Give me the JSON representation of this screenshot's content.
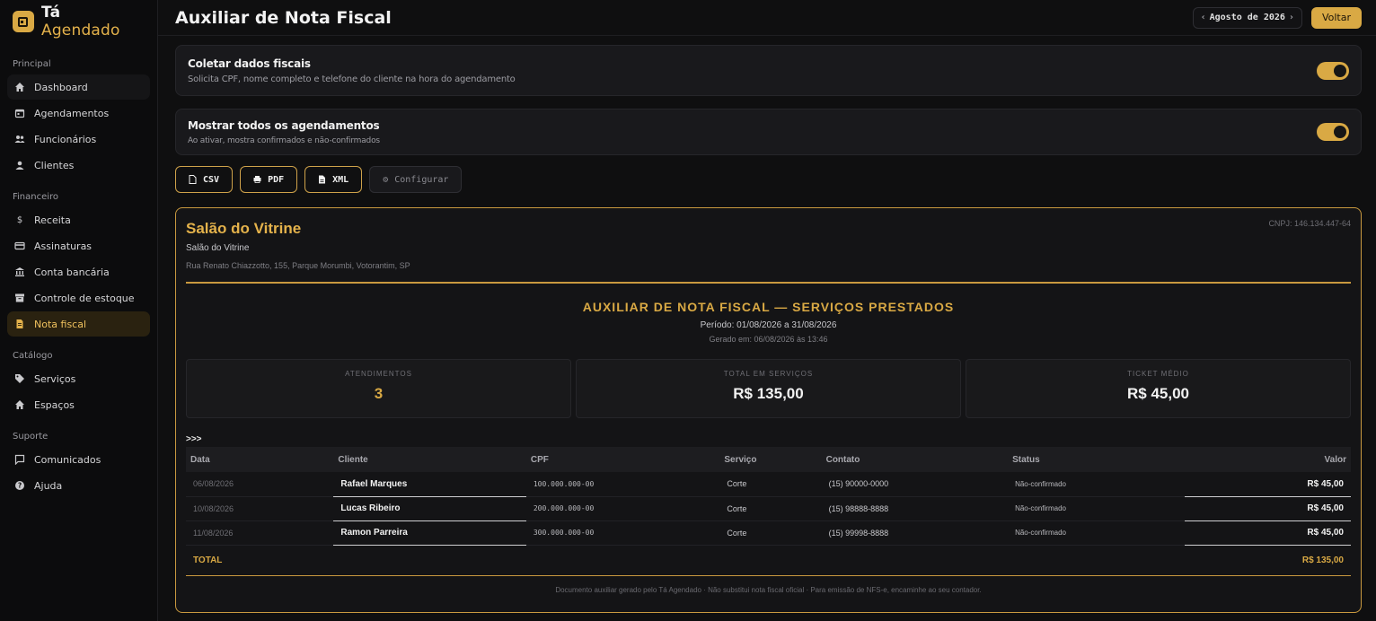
{
  "brand": {
    "name_part1": "Tá",
    "name_part2": "Agendado"
  },
  "sidebar": {
    "sections": [
      {
        "title": "Principal"
      },
      {
        "title": "Financeiro"
      },
      {
        "title": "Catálogo"
      },
      {
        "title": "Suporte"
      }
    ],
    "items": [
      {
        "label": "Dashboard",
        "icon": "home-icon"
      },
      {
        "label": "Agendamentos",
        "icon": "calendar-icon"
      },
      {
        "label": "Funcionários",
        "icon": "users-icon"
      },
      {
        "label": "Clientes",
        "icon": "user-icon"
      },
      {
        "label": "Receita",
        "icon": "dollar-icon"
      },
      {
        "label": "Assinaturas",
        "icon": "credit-card-icon"
      },
      {
        "label": "Conta bancária",
        "icon": "bank-icon"
      },
      {
        "label": "Controle de estoque",
        "icon": "archive-icon"
      },
      {
        "label": "Nota fiscal",
        "icon": "document-icon"
      },
      {
        "label": "Serviços",
        "icon": "tag-icon"
      },
      {
        "label": "Espaços",
        "icon": "home-icon"
      },
      {
        "label": "Comunicados",
        "icon": "message-icon"
      },
      {
        "label": "Ajuda",
        "icon": "help-icon"
      }
    ]
  },
  "header": {
    "title": "Auxiliar de Nota Fiscal",
    "month": "Agosto de 2026",
    "back_label": "Voltar"
  },
  "settings": {
    "collect": {
      "title": "Coletar dados fiscais",
      "desc": "Solicita CPF, nome completo e telefone do cliente na hora do agendamento",
      "enabled": true
    },
    "show_all": {
      "title": "Mostrar todos os agendamentos",
      "desc": "Ao ativar, mostra confirmados e não-confirmados",
      "enabled": true
    }
  },
  "actions": {
    "csv": "CSV",
    "pdf": "PDF",
    "xml": "XML",
    "config": "Configurar"
  },
  "report": {
    "business_name": "Salão do Vitrine",
    "business_sub": "Salão do Vitrine",
    "address": "Rua Renato Chiazzotto, 155, Parque Morumbi, Votorantim, SP",
    "cnpj": "CNPJ: 146.134.447-64",
    "title": "AUXILIAR DE NOTA FISCAL — SERVIÇOS PRESTADOS",
    "period": "Período: 01/08/2026 a 31/08/2026",
    "generated": "Gerado em: 06/08/2026 às 13:46",
    "stats": [
      {
        "label": "ATENDIMENTOS",
        "value": "3"
      },
      {
        "label": "TOTAL EM SERVIÇOS",
        "value": "R$ 135,00"
      },
      {
        "label": "TICKET MÉDIO",
        "value": "R$ 45,00"
      }
    ],
    "marker": ">>>",
    "columns": [
      "Data",
      "Cliente",
      "CPF",
      "Serviço",
      "Contato",
      "Status",
      "Valor"
    ],
    "rows": [
      {
        "date": "06/08/2026",
        "client": "Rafael Marques",
        "cpf": "100.000.000-00",
        "service": "Corte",
        "contact": "(15) 90000-0000",
        "status": "Não-confirmado",
        "value": "R$ 45,00"
      },
      {
        "date": "10/08/2026",
        "client": "Lucas Ribeiro",
        "cpf": "200.000.000-00",
        "service": "Corte",
        "contact": "(15) 98888-8888",
        "status": "Não-confirmado",
        "value": "R$ 45,00"
      },
      {
        "date": "11/08/2026",
        "client": "Ramon Parreira",
        "cpf": "300.000.000-00",
        "service": "Corte",
        "contact": "(15) 99998-8888",
        "status": "Não-confirmado",
        "value": "R$ 45,00"
      }
    ],
    "total_label": "TOTAL",
    "total_value": "R$ 135,00",
    "footer": "Documento auxiliar gerado pelo Tá Agendado · Não substitui nota fiscal oficial · Para emissão de NFS-e, encaminhe ao seu contador."
  },
  "colors": {
    "accent": "#d9a944",
    "background": "#0f0f10",
    "card": "#19191c"
  }
}
